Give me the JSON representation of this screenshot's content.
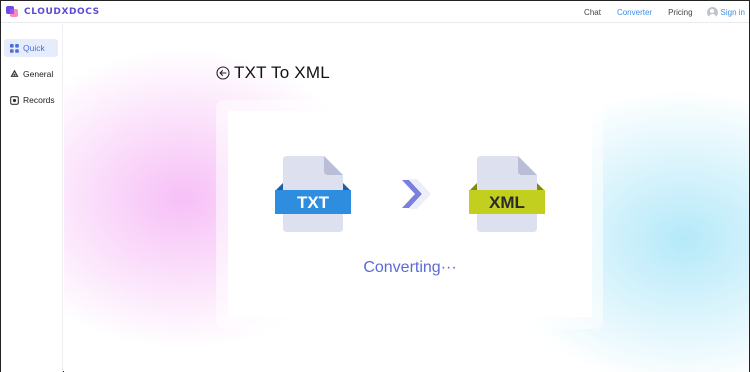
{
  "brand": {
    "name": "CLOUDXDOCS"
  },
  "nav": {
    "items": [
      {
        "label": "Chat",
        "active": false
      },
      {
        "label": "Converter",
        "active": true
      },
      {
        "label": "Pricing",
        "active": false
      }
    ],
    "signin_label": "Sign in"
  },
  "sidebar": {
    "items": [
      {
        "label": "Quick",
        "active": true,
        "icon": "grid-icon"
      },
      {
        "label": "General",
        "active": false,
        "icon": "recycle-icon"
      },
      {
        "label": "Records",
        "active": false,
        "icon": "records-icon"
      }
    ]
  },
  "page": {
    "title": "TXT To XML"
  },
  "conversion": {
    "source": {
      "label": "TXT",
      "color": "#2f8de0"
    },
    "target": {
      "label": "XML",
      "color": "#c2cf1f"
    },
    "status_text": "Converting···"
  },
  "colors": {
    "brand": "#5b4ad9",
    "accent": "#3b8ee6",
    "arrow": "#7b7fe0"
  }
}
